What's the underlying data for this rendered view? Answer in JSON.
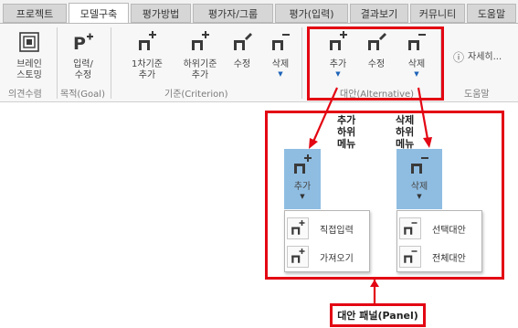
{
  "tabs": [
    {
      "label": "프로젝트",
      "active": false
    },
    {
      "label": "모델구축",
      "active": true
    },
    {
      "label": "평가방법",
      "active": false
    },
    {
      "label": "평가자/그룹",
      "active": false
    },
    {
      "label": "평가(입력)",
      "active": false
    },
    {
      "label": "결과보기",
      "active": false
    },
    {
      "label": "커뮤니티",
      "active": false
    },
    {
      "label": "도움말",
      "active": false
    }
  ],
  "ribbon": {
    "brainstorm": {
      "line1": "브레인",
      "line2": "스토밍",
      "group": "의견수렴"
    },
    "goal": {
      "line1": "입력/",
      "line2": "수정",
      "group": "목적(Goal)"
    },
    "criterion": {
      "add_top": {
        "line1": "1차기준",
        "line2": "추가"
      },
      "add_sub": {
        "line1": "하위기준",
        "line2": "추가"
      },
      "edit": {
        "label": "수정"
      },
      "delete": {
        "label": "삭제"
      },
      "group": "기준(Criterion)"
    },
    "alternative": {
      "add": {
        "label": "추가"
      },
      "edit": {
        "label": "수정"
      },
      "delete": {
        "label": "삭제"
      },
      "group": "대안(Alternative)"
    },
    "help": {
      "label": "자세히...",
      "group": "도움말"
    }
  },
  "annotations": {
    "add_submenu": [
      "추가",
      "하위",
      "메뉴"
    ],
    "delete_submenu": [
      "삭제",
      "하위",
      "메뉴"
    ],
    "panel_label": "대안 패널(Panel)"
  },
  "popups": {
    "add": {
      "button": "추가",
      "items": [
        "직접입력",
        "가져오기"
      ]
    },
    "delete": {
      "button": "삭제",
      "items": [
        "선택대안",
        "전체대안"
      ]
    }
  },
  "colors": {
    "highlight_red": "#e30613",
    "accent_blue": "#1d63b8",
    "button_blue": "#8fbde2"
  }
}
